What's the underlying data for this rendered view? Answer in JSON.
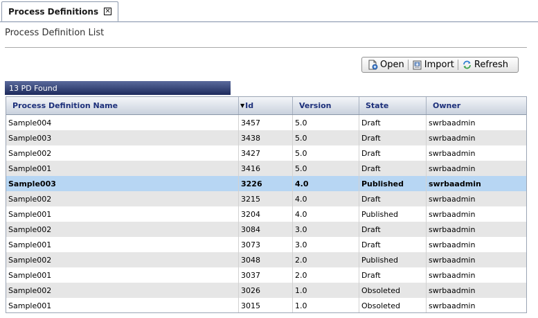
{
  "tab": {
    "label": "Process Definitions",
    "close_glyph": "✕"
  },
  "page": {
    "title": "Process Definition List"
  },
  "toolbar": {
    "open_label": "Open",
    "import_label": "Import",
    "refresh_label": "Refresh"
  },
  "list": {
    "count_text": "13 PD Found",
    "sort_indicator": "▼",
    "columns": [
      "Process Definition Name",
      "Id",
      "Version",
      "State",
      "Owner"
    ],
    "rows": [
      [
        "Sample004",
        "3457",
        "5.0",
        "Draft",
        "swrbaadmin"
      ],
      [
        "Sample003",
        "3438",
        "5.0",
        "Draft",
        "swrbaadmin"
      ],
      [
        "Sample002",
        "3427",
        "5.0",
        "Draft",
        "swrbaadmin"
      ],
      [
        "Sample001",
        "3416",
        "5.0",
        "Draft",
        "swrbaadmin"
      ],
      [
        "Sample003",
        "3226",
        "4.0",
        "Published",
        "swrbaadmin"
      ],
      [
        "Sample002",
        "3215",
        "4.0",
        "Draft",
        "swrbaadmin"
      ],
      [
        "Sample001",
        "3204",
        "4.0",
        "Published",
        "swrbaadmin"
      ],
      [
        "Sample002",
        "3084",
        "3.0",
        "Draft",
        "swrbaadmin"
      ],
      [
        "Sample001",
        "3073",
        "3.0",
        "Draft",
        "swrbaadmin"
      ],
      [
        "Sample002",
        "3048",
        "2.0",
        "Published",
        "swrbaadmin"
      ],
      [
        "Sample001",
        "3037",
        "2.0",
        "Draft",
        "swrbaadmin"
      ],
      [
        "Sample002",
        "3026",
        "1.0",
        "Obsoleted",
        "swrbaadmin"
      ],
      [
        "Sample001",
        "3015",
        "1.0",
        "Obsoleted",
        "swrbaadmin"
      ]
    ],
    "selected_row": 4
  },
  "icons": {
    "open": "open-document-icon",
    "import": "import-icon",
    "refresh": "refresh-icon",
    "tab_close": "close-icon",
    "sort": "sort-descending-icon"
  },
  "colors": {
    "header_text": "#1c2f7a",
    "selected_row": "#b7d6f3",
    "count_band": "#1d2a5c"
  }
}
